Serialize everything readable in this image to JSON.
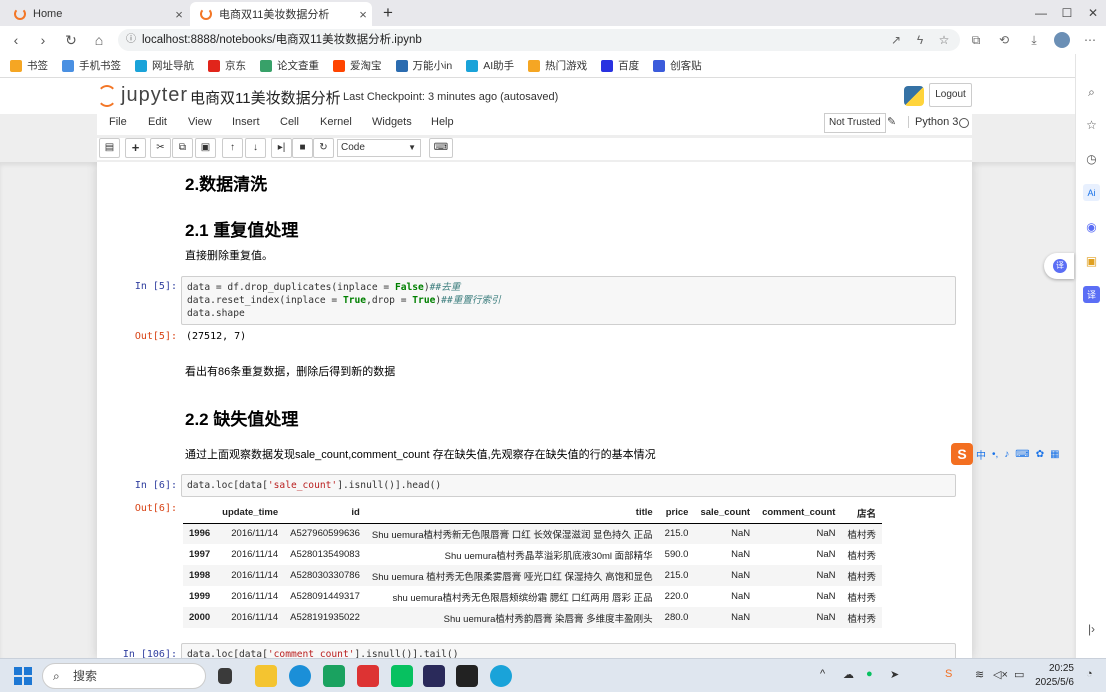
{
  "browser": {
    "tabs": [
      {
        "title": "Home",
        "active": false
      },
      {
        "title": "电商双11美妆数据分析",
        "active": true
      }
    ],
    "url": "localhost:8888/notebooks/电商双11美妆数据分析.ipynb",
    "bookmarks": [
      {
        "label": "书签",
        "color": "#f5a623"
      },
      {
        "label": "手机书签",
        "color": "#4a90e2"
      },
      {
        "label": "网址导航",
        "color": "#1aa3d9"
      },
      {
        "label": "京东",
        "color": "#e1251b"
      },
      {
        "label": "论文查重",
        "color": "#38a169"
      },
      {
        "label": "爱淘宝",
        "color": "#ff4400"
      },
      {
        "label": "万能小in",
        "color": "#2b6cb0"
      },
      {
        "label": "AI助手",
        "color": "#1aa3d9"
      },
      {
        "label": "热门游戏",
        "color": "#f5a623"
      },
      {
        "label": "百度",
        "color": "#2932e1"
      },
      {
        "label": "创客贴",
        "color": "#3b5bdb"
      }
    ]
  },
  "jupyter": {
    "logo_text": "jupyter",
    "notebook_title": "电商双11美妆数据分析",
    "checkpoint": "Last Checkpoint: 3 minutes ago (autosaved)",
    "logout": "Logout",
    "menu": [
      "File",
      "Edit",
      "View",
      "Insert",
      "Cell",
      "Kernel",
      "Widgets",
      "Help"
    ],
    "trust": "Not Trusted",
    "kernel": "Python 3",
    "cell_type": "Code"
  },
  "notebook": {
    "h_clean": "2.数据清洗",
    "h_dup": "2.1 重复值处理",
    "p_dup": "直接删除重复值。",
    "in5": "In  [5]:",
    "out5_prompt": "Out[5]:",
    "out5": "(27512, 7)",
    "p_dup_result": "看出有86条重复数据，删除后得到新的数据",
    "h_missing": "2.2 缺失值处理",
    "p_missing": "通过上面观察数据发现sale_count,comment_count 存在缺失值,先观察存在缺失值的行的基本情况",
    "in6": "In  [6]:",
    "out6_prompt": "Out[6]:",
    "in_next": "In  [106]:",
    "table": {
      "columns": [
        "",
        "update_time",
        "id",
        "title",
        "price",
        "sale_count",
        "comment_count",
        "店名"
      ],
      "rows": [
        [
          "1996",
          "2016/11/14",
          "A527960599636",
          "Shu uemura植村秀新无色限唇膏 口红 长效保湿滋润 显色持久 正品",
          "215.0",
          "NaN",
          "NaN",
          "植村秀"
        ],
        [
          "1997",
          "2016/11/14",
          "A528013549083",
          "Shu uemura植村秀晶萃溢彩肌底液30ml 面部精华",
          "590.0",
          "NaN",
          "NaN",
          "植村秀"
        ],
        [
          "1998",
          "2016/11/14",
          "A528030330786",
          "Shu uemura 植村秀无色限柔雾唇膏 哑光口红 保湿持久 高饱和显色",
          "215.0",
          "NaN",
          "NaN",
          "植村秀"
        ],
        [
          "1999",
          "2016/11/14",
          "A528091449317",
          "shu uemura植村秀无色限唇颊缤纷霜 腮红 口红两用 唇彩 正品",
          "220.0",
          "NaN",
          "NaN",
          "植村秀"
        ],
        [
          "2000",
          "2016/11/14",
          "A528191935022",
          "Shu uemura植村秀韵唇膏 染唇膏 多维度丰盈刚头",
          "280.0",
          "NaN",
          "NaN",
          "植村秀"
        ]
      ]
    }
  },
  "taskbar": {
    "search_placeholder": "搜索",
    "time": "20:25",
    "date": "2025/5/6"
  }
}
